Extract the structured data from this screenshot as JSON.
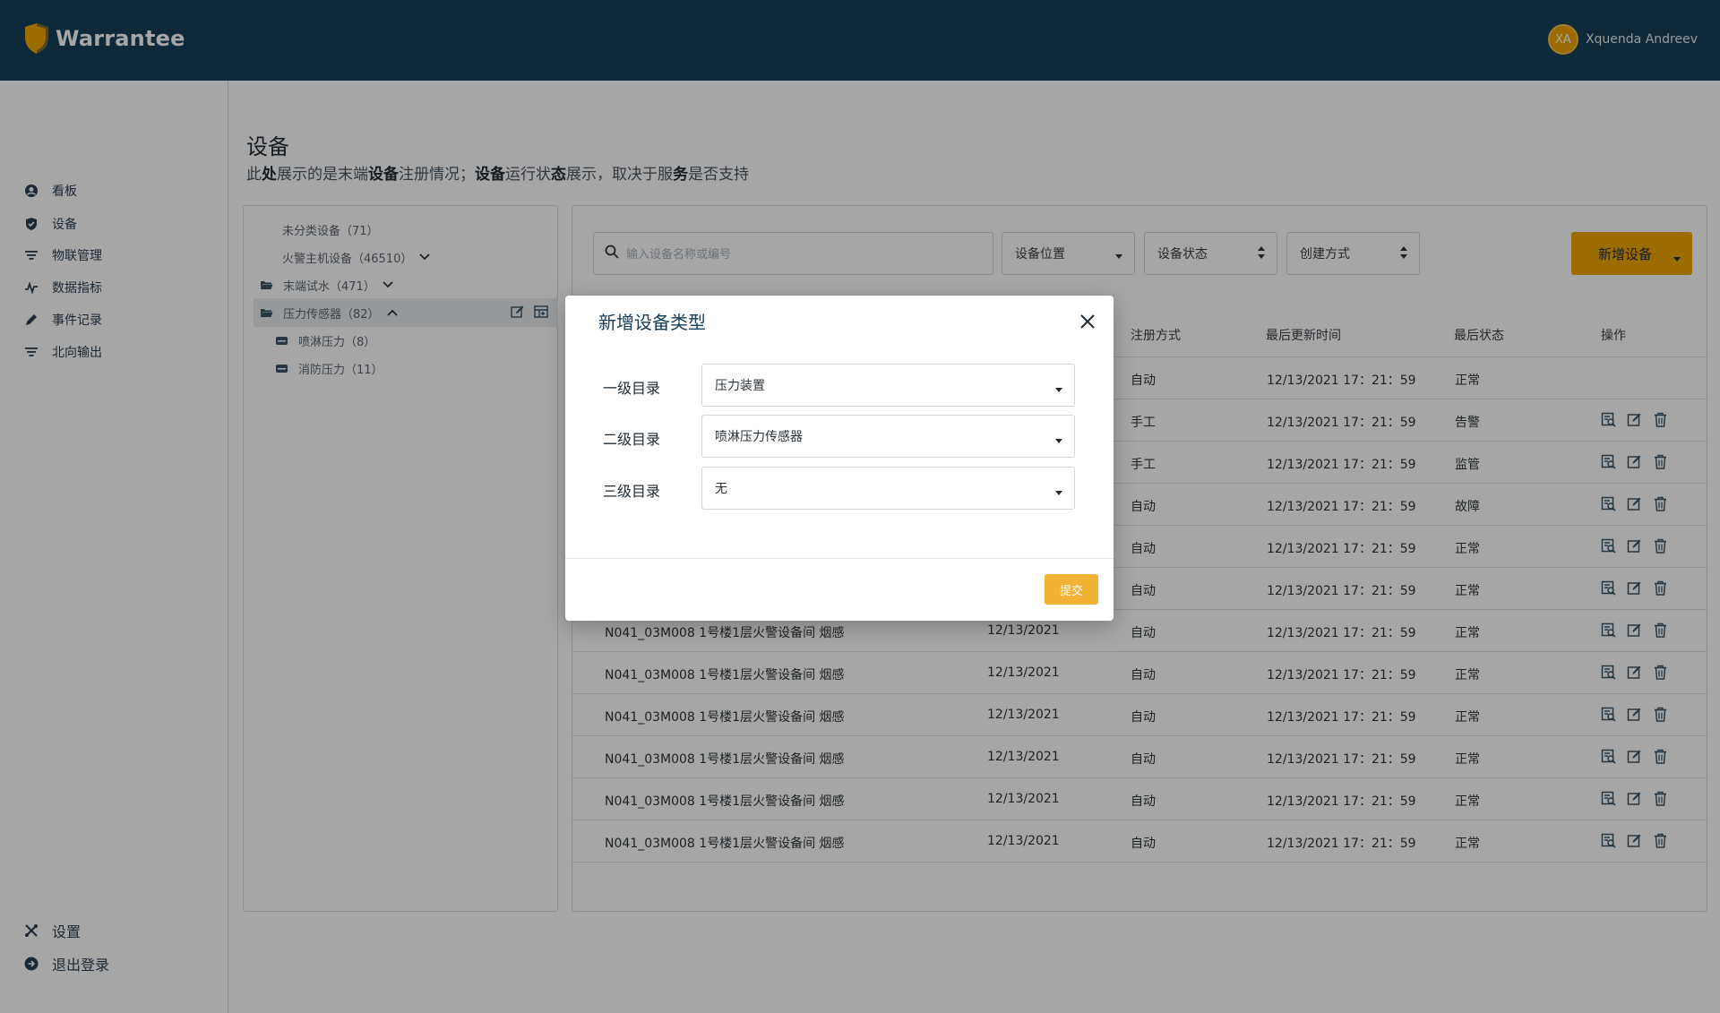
{
  "app": {
    "name": "Warrantee"
  },
  "user": {
    "initials": "XA",
    "name": "Xquenda Andreev"
  },
  "sidebar": {
    "items": [
      {
        "label": "看板",
        "icon": "user-circle-icon"
      },
      {
        "label": "设备",
        "icon": "shield-check-icon"
      },
      {
        "label": "物联管理",
        "icon": "filter-lines-icon"
      },
      {
        "label": "数据指标",
        "icon": "pulse-icon"
      },
      {
        "label": "事件记录",
        "icon": "pencil-icon"
      },
      {
        "label": "北向输出",
        "icon": "filter-lines-icon"
      }
    ],
    "bottom": [
      {
        "label": "设置",
        "icon": "tools-icon"
      },
      {
        "label": "退出登录",
        "icon": "arrow-right-circle-icon"
      }
    ]
  },
  "page": {
    "title": "设备",
    "desc_parts": [
      "此",
      "处",
      "展示的是末端",
      "设备",
      "注册情况；",
      "设备",
      "运行状",
      "态",
      "展示，取决于服",
      "务",
      "是否支持"
    ]
  },
  "tree": {
    "items": [
      {
        "label": "未分类设备（71）"
      },
      {
        "label": "火警主机设备（46510）"
      },
      {
        "label": "末端试水（471）"
      },
      {
        "label": "压力传感器（82）"
      },
      {
        "label": "喷淋压力（8）"
      },
      {
        "label": "消防压力（11）"
      }
    ]
  },
  "toolbar": {
    "search_placeholder": "输入设备名称或编号",
    "filter_location": "设备位置",
    "filter_status": "设备状态",
    "filter_method": "创建方式",
    "add_label": "新增设备"
  },
  "table": {
    "headers": {
      "method": "注册方式",
      "updated": "最后更新时间",
      "status": "最后状态",
      "actions": "操作"
    },
    "rows": [
      {
        "name": "",
        "date": "",
        "method": "自动",
        "updated": "12/13/2021 17：21：59",
        "status": "正常",
        "actions": false
      },
      {
        "name": "",
        "date": "",
        "method": "手工",
        "updated": "12/13/2021 17：21：59",
        "status": "告警",
        "actions": true
      },
      {
        "name": "",
        "date": "",
        "method": "手工",
        "updated": "12/13/2021 17：21：59",
        "status": "监管",
        "actions": true
      },
      {
        "name": "",
        "date": "",
        "method": "自动",
        "updated": "12/13/2021 17：21：59",
        "status": "故障",
        "actions": true
      },
      {
        "name": "",
        "date": "",
        "method": "自动",
        "updated": "12/13/2021 17：21：59",
        "status": "正常",
        "actions": true
      },
      {
        "name": "",
        "date": "",
        "method": "自动",
        "updated": "12/13/2021 17：21：59",
        "status": "正常",
        "actions": true
      },
      {
        "name": "N041_03M008 1号楼1层火警设备间 烟感",
        "date": "12/13/2021",
        "method": "自动",
        "updated": "12/13/2021 17：21：59",
        "status": "正常",
        "actions": true
      },
      {
        "name": "N041_03M008 1号楼1层火警设备间 烟感",
        "date": "12/13/2021",
        "method": "自动",
        "updated": "12/13/2021 17：21：59",
        "status": "正常",
        "actions": true
      },
      {
        "name": "N041_03M008 1号楼1层火警设备间 烟感",
        "date": "12/13/2021",
        "method": "自动",
        "updated": "12/13/2021 17：21：59",
        "status": "正常",
        "actions": true
      },
      {
        "name": "N041_03M008 1号楼1层火警设备间 烟感",
        "date": "12/13/2021",
        "method": "自动",
        "updated": "12/13/2021 17：21：59",
        "status": "正常",
        "actions": true
      },
      {
        "name": "N041_03M008 1号楼1层火警设备间 烟感",
        "date": "12/13/2021",
        "method": "自动",
        "updated": "12/13/2021 17：21：59",
        "status": "正常",
        "actions": true
      },
      {
        "name": "N041_03M008 1号楼1层火警设备间 烟感",
        "date": "12/13/2021",
        "method": "自动",
        "updated": "12/13/2021 17：21：59",
        "status": "正常",
        "actions": true
      }
    ]
  },
  "modal": {
    "title": "新增设备类型",
    "fields": [
      {
        "label": "一级目录",
        "value": "压力装置"
      },
      {
        "label": "二级目录",
        "value": "喷淋压力传感器"
      },
      {
        "label": "三级目录",
        "value": "无"
      }
    ],
    "submit_label": "提交"
  },
  "colors": {
    "header_bg": "#16405a",
    "accent": "#f2a600",
    "overlay": "rgba(0,0,0,0.35)"
  }
}
